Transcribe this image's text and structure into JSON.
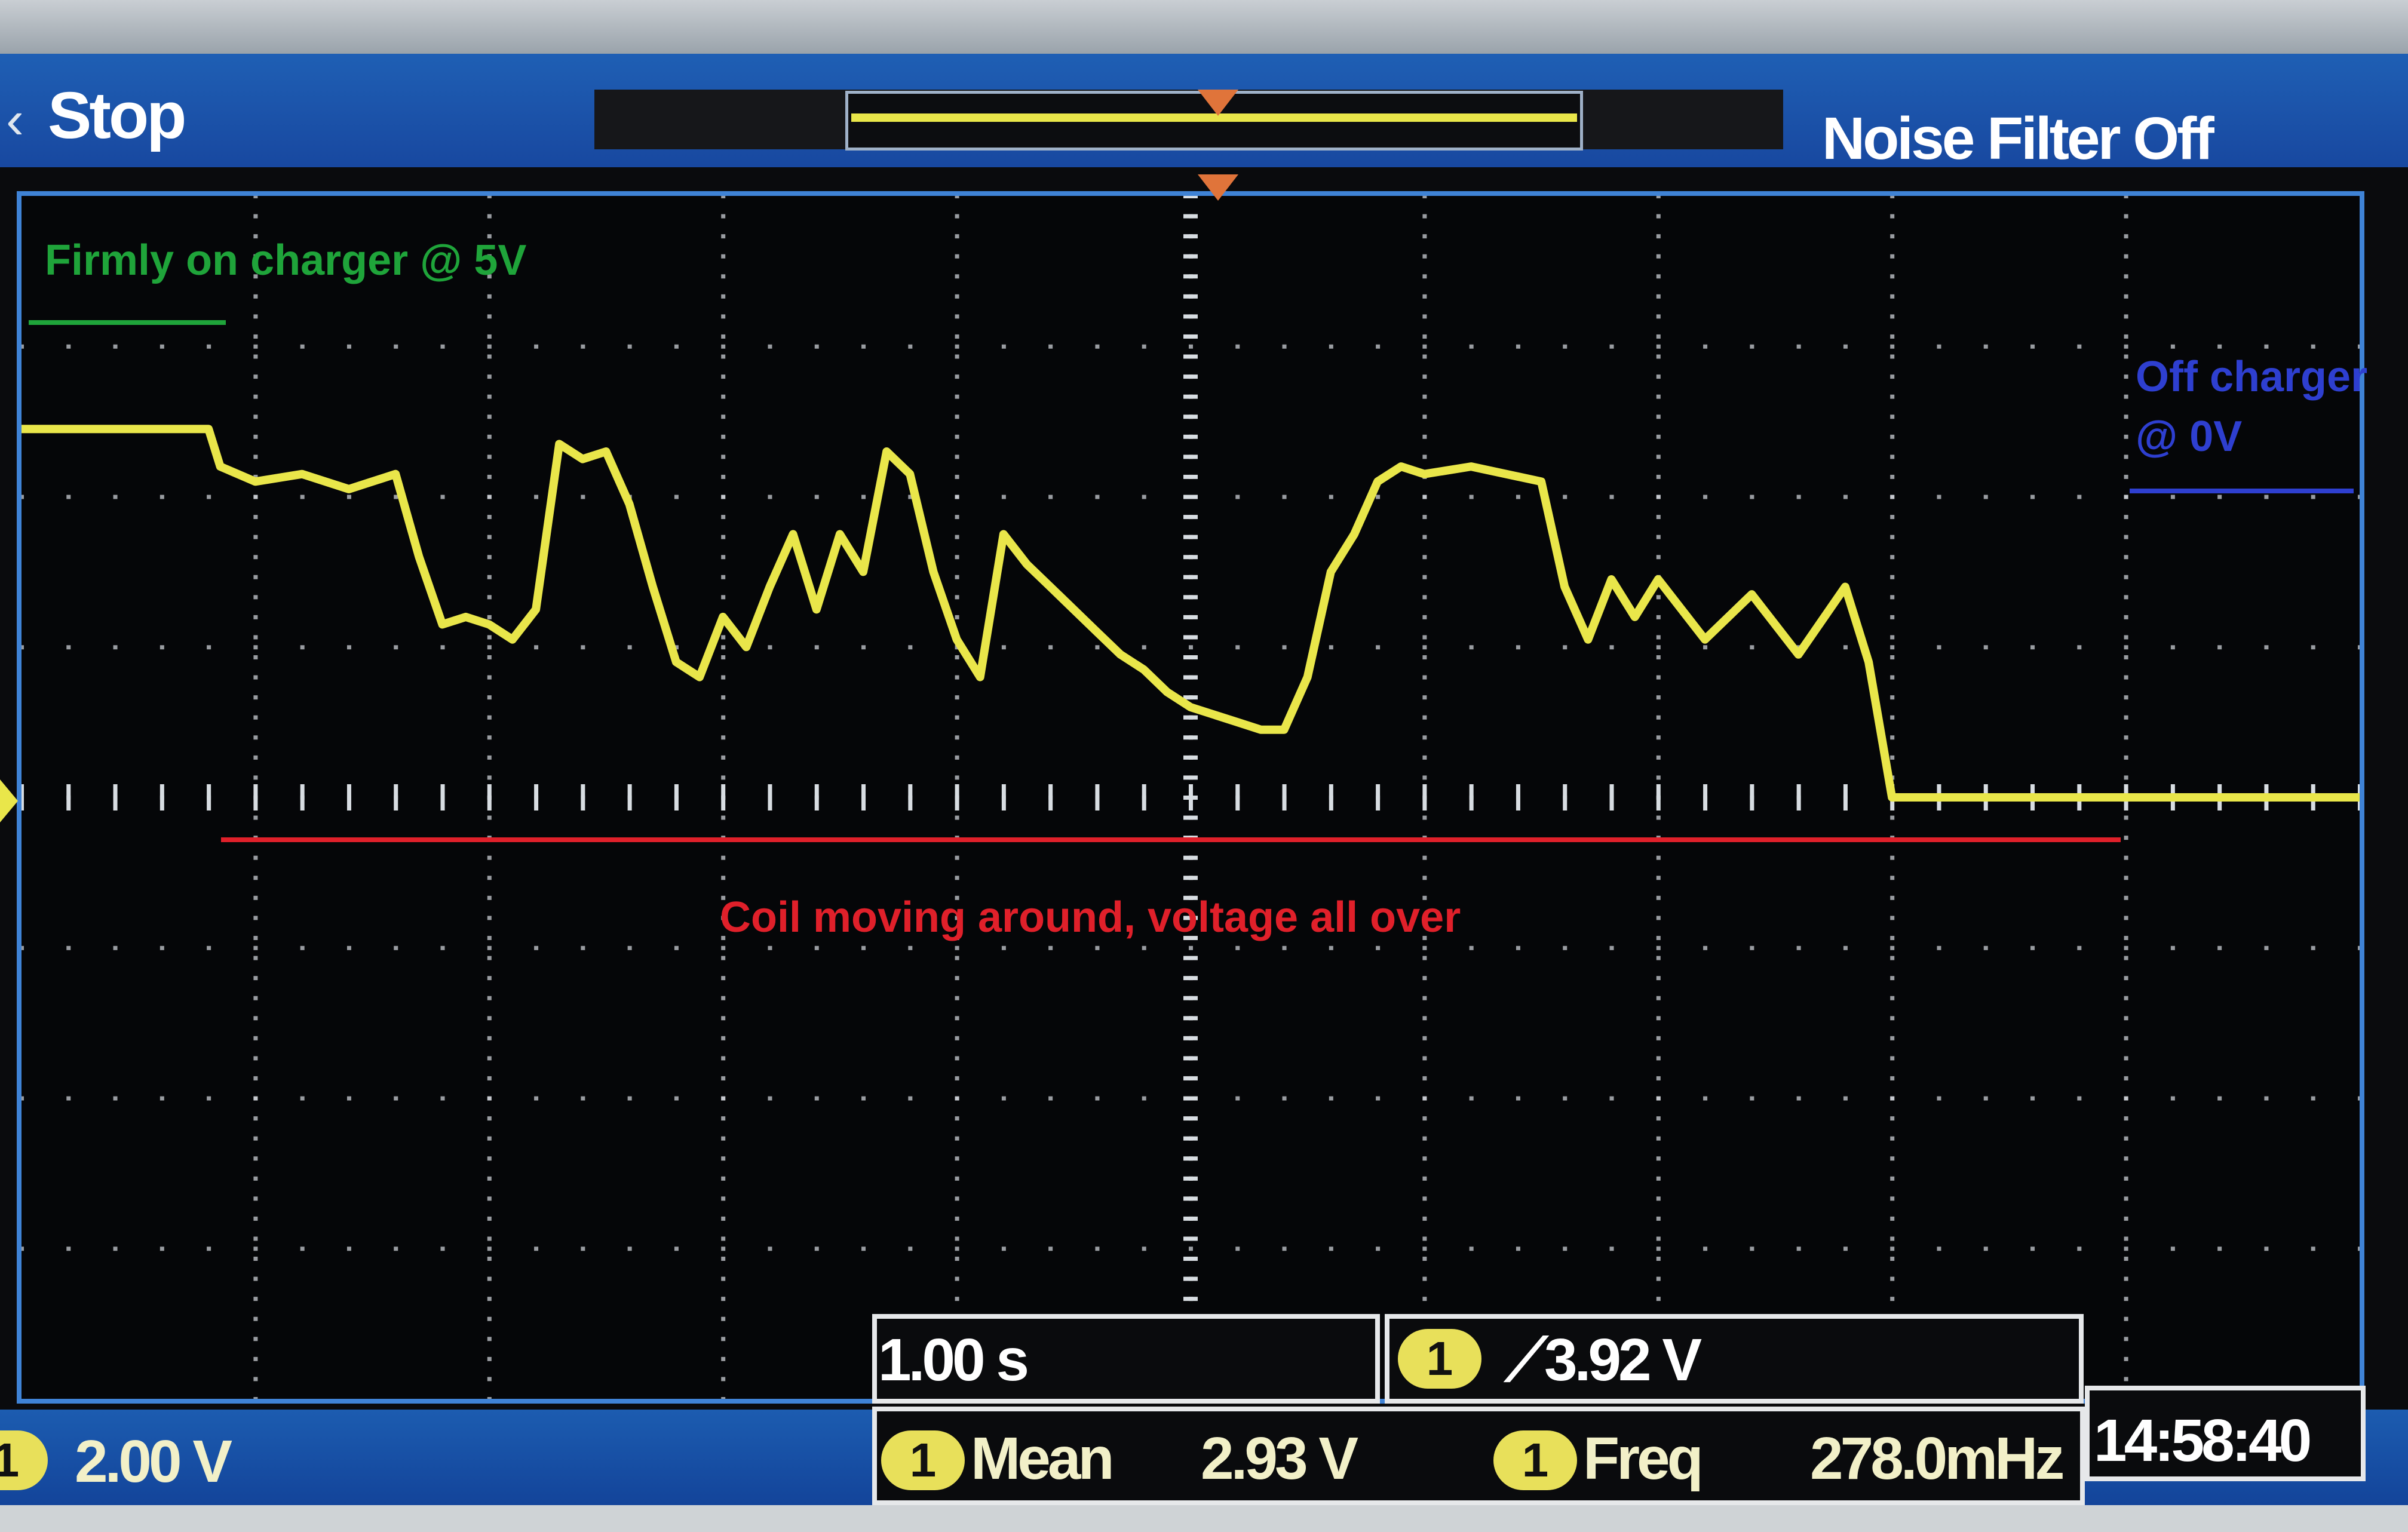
{
  "status": {
    "run_state": "Stop",
    "noise_filter": "Noise Filter Off"
  },
  "annotations": {
    "on_charger": "Firmly on charger @ 5V",
    "off_charger_line1": "Off charger",
    "off_charger_line2": "@ 0V",
    "coil_moving": "Coil moving around, voltage all over"
  },
  "readouts": {
    "channel_badge": "1",
    "volts_per_div": "2.00 V",
    "timebase": "1.00 s",
    "trigger_level": "3.92 V",
    "mean_label": "Mean",
    "mean_value": "2.93 V",
    "freq_label": "Freq",
    "freq_value": "278.0mHz",
    "clock": "14:58:40"
  },
  "colors": {
    "trace": "#e9e64a",
    "grid": "#d8dde2",
    "annotation_on": "#1fa43a",
    "annotation_off": "#2e3fd0",
    "annotation_moving": "#e0202a"
  },
  "chart_data": {
    "type": "line",
    "title": "",
    "xlabel": "",
    "ylabel": "",
    "grid": true,
    "x_divisions": 10,
    "y_divisions": 8,
    "xlim": [
      0,
      10
    ],
    "ylim": [
      -8,
      8
    ],
    "series": [
      {
        "values_x": [
          0,
          0.8,
          0.85,
          1.0,
          1.2,
          1.4,
          1.6,
          1.7,
          1.8,
          1.9,
          2.0,
          2.1,
          2.2,
          2.3,
          2.4,
          2.5,
          2.6,
          2.7,
          2.8,
          2.9,
          3.0,
          3.1,
          3.2,
          3.3,
          3.4,
          3.5,
          3.6,
          3.7,
          3.8,
          3.9,
          4.0,
          4.1,
          4.2,
          4.3,
          4.4,
          4.5,
          4.6,
          4.7,
          4.8,
          4.9,
          5.0,
          5.1,
          5.2,
          5.3,
          5.4,
          5.5,
          5.6,
          5.7,
          5.8,
          5.9,
          6.0,
          6.2,
          6.5,
          6.6,
          6.7,
          6.8,
          6.9,
          7.0,
          7.2,
          7.4,
          7.6,
          7.8,
          7.9,
          8.0,
          8.1,
          8.2,
          8.3,
          8.4,
          8.5,
          8.6,
          8.7,
          8.8,
          8.85,
          8.9,
          10
        ],
        "values_y": [
          4.9,
          4.9,
          4.4,
          4.2,
          4.3,
          4.1,
          4.3,
          3.2,
          2.3,
          2.4,
          2.3,
          2.1,
          2.5,
          4.7,
          4.5,
          4.6,
          3.9,
          2.8,
          1.8,
          1.6,
          2.4,
          2.0,
          2.8,
          3.5,
          2.5,
          3.5,
          3.0,
          4.6,
          4.3,
          3.0,
          2.1,
          1.6,
          3.5,
          3.1,
          2.8,
          2.5,
          2.2,
          1.9,
          1.7,
          1.4,
          1.2,
          1.1,
          1.0,
          0.9,
          0.9,
          1.6,
          3.0,
          3.5,
          4.2,
          4.4,
          4.3,
          4.4,
          4.2,
          2.8,
          2.1,
          2.9,
          2.4,
          2.9,
          2.1,
          2.7,
          1.9,
          2.8,
          1.8,
          0.0,
          0.0,
          0.0,
          0.0,
          0.0,
          0.0,
          0.0,
          0.0,
          0.0,
          0.0,
          0.0,
          0.0
        ]
      }
    ]
  }
}
